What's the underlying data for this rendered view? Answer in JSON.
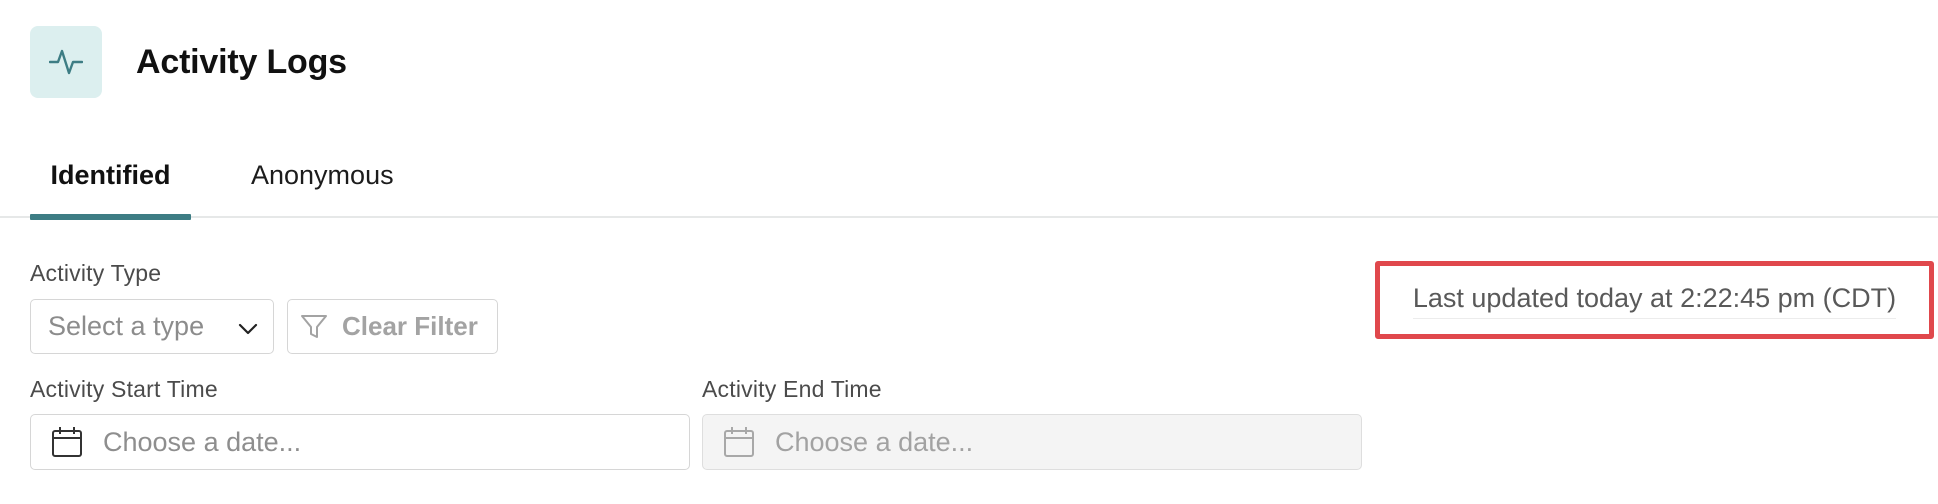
{
  "header": {
    "icon": "activity-pulse-icon",
    "title": "Activity Logs"
  },
  "tabs": [
    {
      "label": "Identified",
      "active": true
    },
    {
      "label": "Anonymous",
      "active": false
    }
  ],
  "filters": {
    "activity_type_label": "Activity Type",
    "type_select_placeholder": "Select a type",
    "clear_filter_label": "Clear Filter",
    "start_time_label": "Activity Start Time",
    "start_placeholder": "Choose a date...",
    "end_time_label": "Activity End Time",
    "end_placeholder": "Choose a date..."
  },
  "status": {
    "last_updated": "Last updated today at 2:22:45 pm (CDT)"
  },
  "colors": {
    "accent": "#3d7d84",
    "icon_bg": "#dcefef",
    "highlight_border": "#e0484c"
  }
}
